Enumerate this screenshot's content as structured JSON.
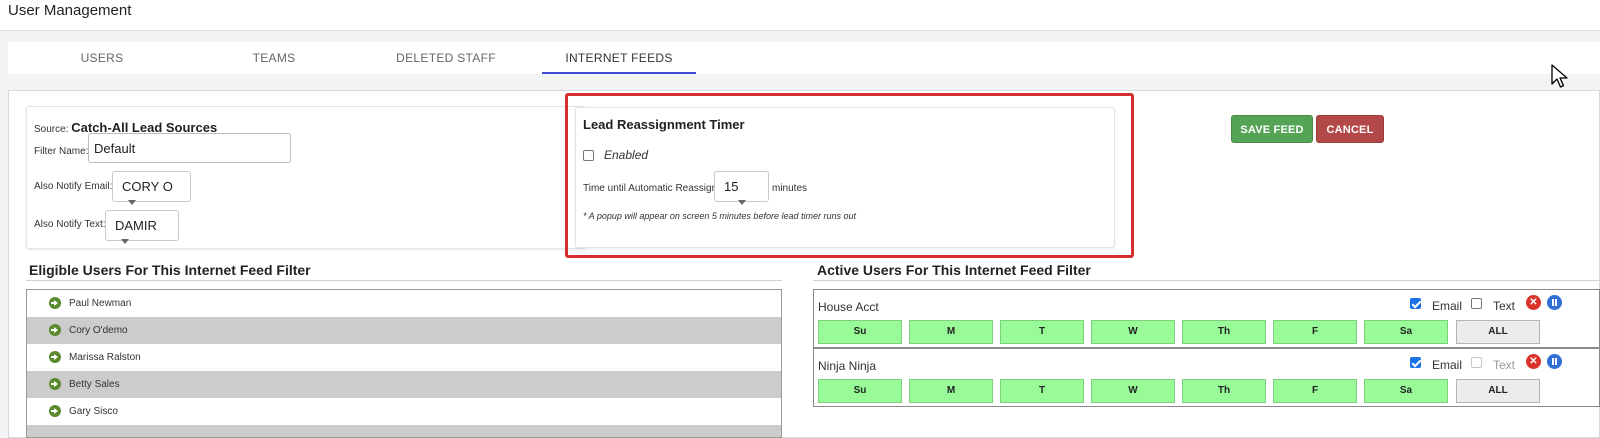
{
  "page": {
    "title": "User Management"
  },
  "tabs": [
    {
      "label": "USERS",
      "active": false
    },
    {
      "label": "TEAMS",
      "active": false
    },
    {
      "label": "DELETED STAFF",
      "active": false
    },
    {
      "label": "INTERNET FEEDS",
      "active": true
    }
  ],
  "source_panel": {
    "source_label": "Source:",
    "source_name": "Catch-All Lead Sources",
    "filter_name_label": "Filter Name:",
    "filter_name_value": "Default",
    "notify_email_label": "Also Notify Email:",
    "notify_email_value": "CORY O",
    "notify_text_label": "Also Notify Text:",
    "notify_text_value": "DAMIR"
  },
  "timer_panel": {
    "title": "Lead Reassignment Timer",
    "enabled_label": "Enabled",
    "enabled": false,
    "time_label": "Time until Automatic Reassign",
    "time_value": "15",
    "time_unit": "minutes",
    "note": "* A popup will appear on screen 5 minutes before lead timer runs out"
  },
  "actions": {
    "save_label": "SAVE FEED",
    "cancel_label": "CANCEL"
  },
  "eligible": {
    "title": "Eligible Users For This Internet Feed Filter",
    "users": [
      "Paul Newman",
      "Cory O'demo",
      "Marissa Ralston",
      "Betty Sales",
      "Gary Sisco"
    ]
  },
  "active": {
    "title": "Active Users For This Internet Feed Filter",
    "email_label": "Email",
    "text_label": "Text",
    "remove_glyph": "✕",
    "days": [
      "Su",
      "M",
      "T",
      "W",
      "Th",
      "F",
      "Sa"
    ],
    "all_label": "ALL",
    "users": [
      {
        "name": "House Acct",
        "email": true,
        "text": false,
        "text_disabled": false
      },
      {
        "name": "Ninja Ninja",
        "email": true,
        "text": false,
        "text_disabled": true
      }
    ]
  },
  "colors": {
    "accent": "#3b4bd8",
    "save": "#55a355",
    "cancel": "#b24848",
    "highlight": "#d32f2f",
    "day_active": "#98fb98",
    "alt_row": "#cccccc"
  },
  "icons": [
    "arrow-right-circle-icon",
    "remove-icon",
    "pause-icon",
    "chevron-down-icon",
    "mouse-cursor-icon"
  ]
}
